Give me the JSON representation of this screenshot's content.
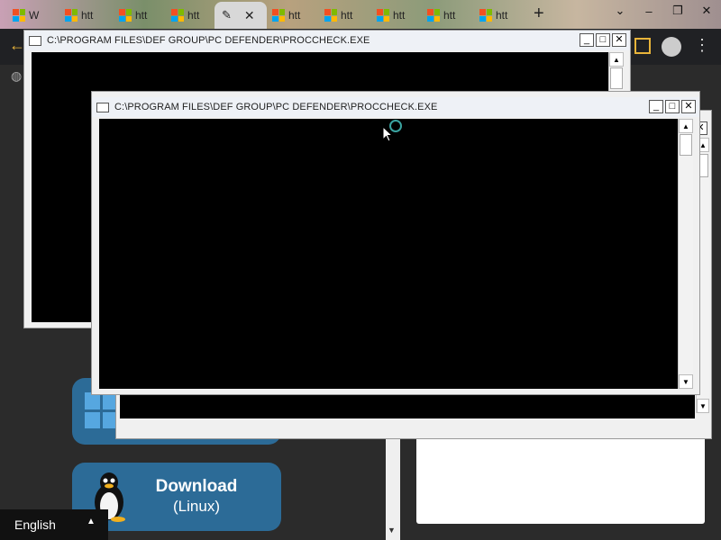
{
  "browser": {
    "tabs": [
      {
        "label": "W"
      },
      {
        "label": "htt"
      },
      {
        "label": "htt"
      },
      {
        "label": "htt"
      },
      {
        "label": "",
        "active": true
      },
      {
        "label": "htt"
      },
      {
        "label": "htt"
      },
      {
        "label": "htt"
      },
      {
        "label": "htt"
      },
      {
        "label": "htt"
      }
    ],
    "new_tab": "+",
    "window_controls": {
      "chevron": "⌄",
      "minimize": "–",
      "restore": "❐",
      "close": "✕"
    }
  },
  "page": {
    "download_linux": {
      "title": "Download",
      "subtitle": "(Linux)"
    },
    "language": {
      "label": "English",
      "caret": "▲"
    }
  },
  "dialogs": [
    {
      "title": "C:\\PROGRAM FILES\\DEF GROUP\\PC DEFENDER\\PROCCHECK.EXE"
    },
    {
      "title": "C:\\PROGRAM FILES\\DEF GROUP\\PC DEFENDER\\PROCCHECK.EXE"
    }
  ],
  "dialog_buttons": {
    "minimize": "_",
    "maximize": "□",
    "close": "✕"
  },
  "scroll": {
    "up": "▲",
    "down": "▼"
  },
  "colors": {
    "accent": "#e8b43a",
    "button_blue": "#2c6b97",
    "console": "#000000"
  }
}
